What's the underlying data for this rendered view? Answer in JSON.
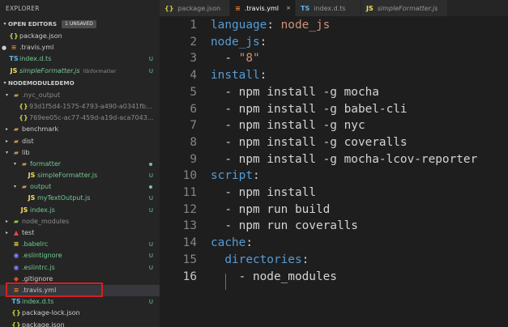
{
  "sidebar": {
    "title": "EXPLORER",
    "open_editors": {
      "label": "OPEN EDITORS",
      "badge": "1 UNSAVED",
      "items": [
        {
          "name": "package.json",
          "icon": "json-icon",
          "status": ""
        },
        {
          "name": ".travis.yml",
          "icon": "yml-icon",
          "status": ""
        },
        {
          "name": "index.d.ts",
          "icon": "ts-icon",
          "status": "U"
        },
        {
          "name": "simpleFormatter.js",
          "sub": "lib\\formatter",
          "icon": "js-icon",
          "status": "U"
        }
      ]
    },
    "project": {
      "label": "NODEMODULEDEMO",
      "items": [
        {
          "name": ".nyc_output"
        },
        {
          "name": "93d1f5d4-1575-4793-a490-a0341fb..."
        },
        {
          "name": "769ee05c-ac77-459d-a19d-aca7043..."
        },
        {
          "name": "benchmark"
        },
        {
          "name": "dist"
        },
        {
          "name": "lib"
        },
        {
          "name": "formatter"
        },
        {
          "name": "simpleFormatter.js",
          "status": "U"
        },
        {
          "name": "output"
        },
        {
          "name": "myTextOutput.js",
          "status": "U"
        },
        {
          "name": "index.js",
          "status": "U"
        },
        {
          "name": "node_modules"
        },
        {
          "name": "test"
        },
        {
          "name": ".babelrc",
          "status": "U"
        },
        {
          "name": ".eslintignore",
          "status": "U"
        },
        {
          "name": ".eslintrc.js",
          "status": "U"
        },
        {
          "name": ".gitignore"
        },
        {
          "name": ".travis.yml"
        },
        {
          "name": "index.d.ts",
          "status": "U"
        },
        {
          "name": "package-lock.json"
        },
        {
          "name": "package.json"
        }
      ]
    }
  },
  "tabs": [
    {
      "label": "package.json",
      "icon": "json-icon"
    },
    {
      "label": ".travis.yml",
      "icon": "yml-icon",
      "active": true
    },
    {
      "label": "index.d.ts",
      "icon": "ts-icon"
    },
    {
      "label": "simpleFormatter.js",
      "icon": "js-icon"
    }
  ],
  "editor": {
    "line_numbers": [
      "1",
      "2",
      "3",
      "4",
      "5",
      "6",
      "7",
      "8",
      "9",
      "10",
      "11",
      "12",
      "13",
      "14",
      "15",
      "16"
    ],
    "lines": [
      {
        "key": "language",
        "sep": ": ",
        "value": "node_js"
      },
      {
        "key": "node_js",
        "sep": ":",
        "value": ""
      },
      {
        "dash": "  - ",
        "str": "\"8\""
      },
      {
        "key": "install",
        "sep": ":",
        "value": ""
      },
      {
        "dash": "  - ",
        "value": "npm install -g mocha"
      },
      {
        "dash": "  - ",
        "value": "npm install -g babel-cli"
      },
      {
        "dash": "  - ",
        "value": "npm install -g nyc"
      },
      {
        "dash": "  - ",
        "value": "npm install -g coveralls"
      },
      {
        "dash": "  - ",
        "value": "npm install -g mocha-lcov-reporter"
      },
      {
        "key": "script",
        "sep": ":",
        "value": ""
      },
      {
        "dash": "  - ",
        "value": "npm install"
      },
      {
        "dash": "  - ",
        "value": "npm run build"
      },
      {
        "dash": "  - ",
        "value": "npm run coveralls"
      },
      {
        "key": "cache",
        "sep": ":",
        "value": ""
      },
      {
        "indent": "  ",
        "key": "directories",
        "sep": ":",
        "value": ""
      },
      {
        "dash": "    - ",
        "value": "node_modules"
      }
    ]
  },
  "icons": {
    "json": "{}",
    "yml": "≡",
    "ts": "TS",
    "js": "JS",
    "folder_open": "▰",
    "folder_closed": "▰",
    "caret_open": "▾",
    "caret_closed": "▸",
    "close": "×",
    "modified_dot": "●"
  },
  "colors": {
    "keyword": "#569cd6",
    "string": "#ce9178",
    "untracked": "#73c991",
    "highlight_box": "#d52020"
  }
}
